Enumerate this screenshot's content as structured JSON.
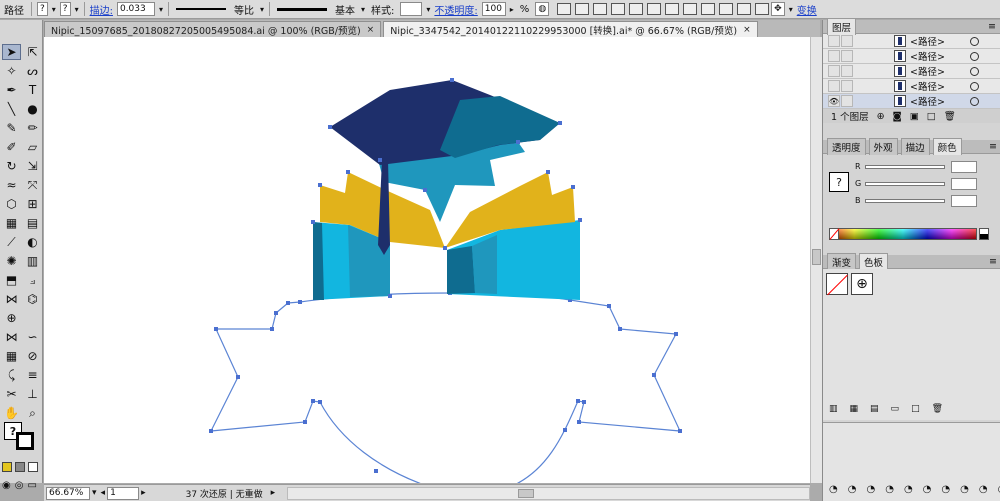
{
  "control_bar": {
    "object_type": "路径",
    "stroke_label": "描边:",
    "stroke_value": "0.033",
    "profile_label": "等比",
    "brush_label": "基本",
    "style_label": "样式:",
    "opacity_label": "不透明度:",
    "opacity_value": "100",
    "opacity_unit": "%",
    "transform_link": "变换"
  },
  "tabs": [
    {
      "label": "Nipic_15097685_20180827205005495084.ai @ 100% (RGB/预览)",
      "close": "×"
    },
    {
      "label": "Nipic_3347542_20140122110229953000 [转换].ai* @ 66.67% (RGB/预览)",
      "close": "×"
    }
  ],
  "status_bar": {
    "zoom": "66.67%",
    "artboard": "1",
    "message": "37 次还原 | 无重做"
  },
  "layers_panel": {
    "title": "图层",
    "items": [
      {
        "label": "<路径>"
      },
      {
        "label": "<路径>"
      },
      {
        "label": "<路径>"
      },
      {
        "label": "<路径>"
      },
      {
        "label": "<路径>"
      }
    ],
    "footer": "1 个图层"
  },
  "color_panel": {
    "tabs": [
      "透明度",
      "外观",
      "描边",
      "颜色"
    ],
    "active_tab": "颜色",
    "channels": [
      "R",
      "G",
      "B"
    ]
  },
  "swatch_panel": {
    "tabs": [
      "渐变",
      "色板"
    ],
    "active_tab": "色板"
  },
  "colors": {
    "navy": "#1e2f6b",
    "teal": "#0f6c90",
    "sky": "#1aa9d6",
    "cyan": "#12b6e0",
    "gold": "#e1b21b",
    "mid_blue": "#2387b8",
    "outline": "#5b84d4"
  },
  "icons": [
    "selection-tool-icon",
    "direct-selection-tool-icon",
    "magic-wand-icon",
    "lasso-icon",
    "pen-icon",
    "type-icon",
    "line-icon",
    "ellipse-icon",
    "brush-icon",
    "pencil-icon",
    "eraser-icon",
    "rotate-icon",
    "scale-icon",
    "warp-icon",
    "free-transform-icon",
    "symbol-sprayer-icon",
    "graph-icon",
    "mesh-icon",
    "gradient-icon",
    "eyedropper-icon",
    "blend-icon",
    "slice-icon",
    "scissors-icon",
    "hand-icon",
    "zoom-icon"
  ]
}
